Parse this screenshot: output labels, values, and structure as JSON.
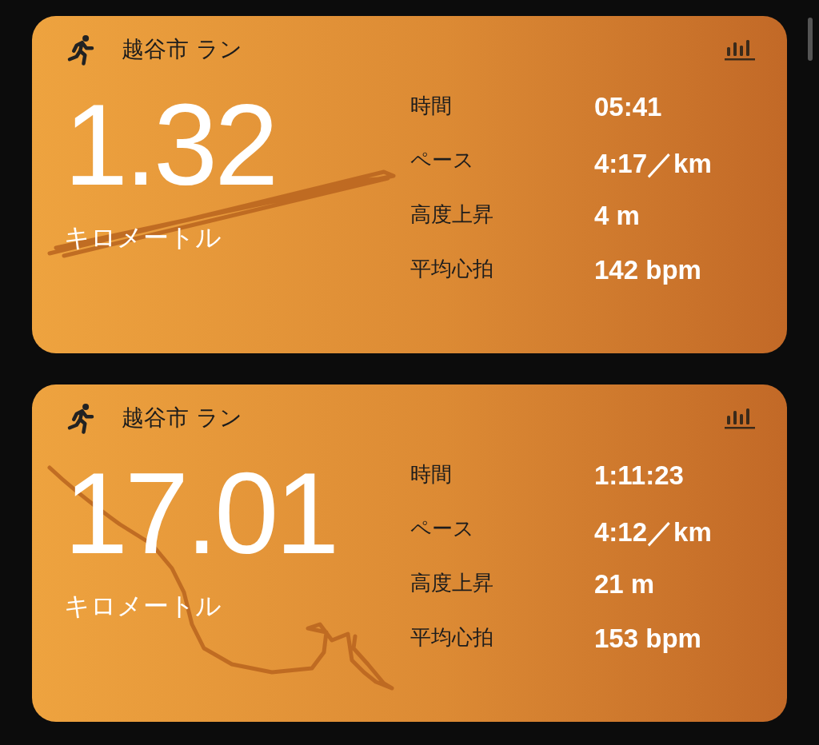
{
  "workouts": [
    {
      "title": "越谷市 ラン",
      "distance": "1.32",
      "unit": "キロメートル",
      "stats": [
        {
          "label": "時間",
          "value": "05:41"
        },
        {
          "label": "ペース",
          "value": "4:17／km"
        },
        {
          "label": "高度上昇",
          "value": "4 m"
        },
        {
          "label": "平均心拍",
          "value": "142 bpm"
        }
      ]
    },
    {
      "title": "越谷市 ラン",
      "distance": "17.01",
      "unit": "キロメートル",
      "stats": [
        {
          "label": "時間",
          "value": "1:11:23"
        },
        {
          "label": "ペース",
          "value": "4:12／km"
        },
        {
          "label": "高度上昇",
          "value": "21 m"
        },
        {
          "label": "平均心拍",
          "value": "153 bpm"
        }
      ]
    }
  ]
}
